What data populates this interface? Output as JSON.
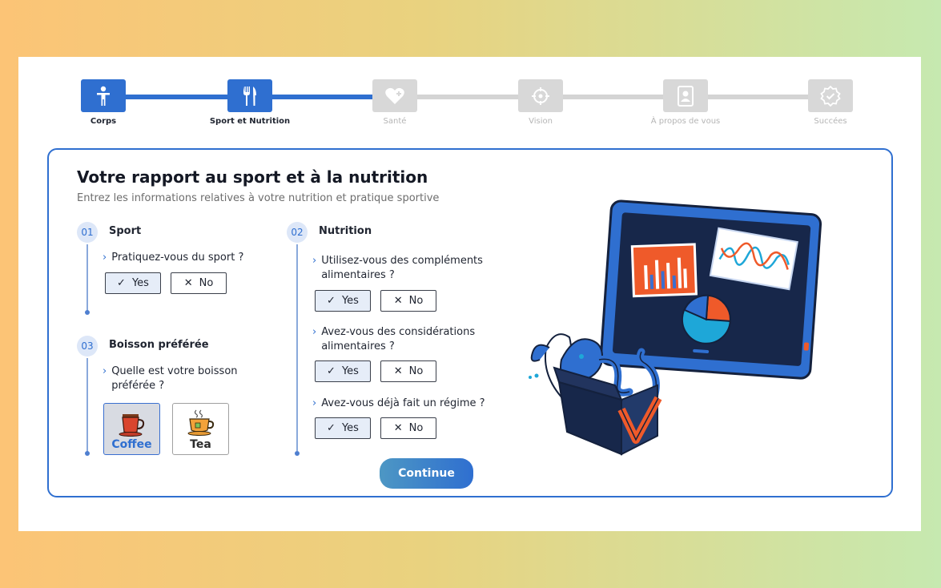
{
  "stepper": {
    "steps": [
      {
        "label": "Corps",
        "icon": "person-icon",
        "state": "done"
      },
      {
        "label": "Sport et Nutrition",
        "icon": "fork-knife-icon",
        "state": "current"
      },
      {
        "label": "Santé",
        "icon": "heart-plus-icon",
        "state": "todo"
      },
      {
        "label": "Vision",
        "icon": "target-icon",
        "state": "todo"
      },
      {
        "label": "À propos de vous",
        "icon": "profile-document-icon",
        "state": "todo"
      },
      {
        "label": "Succées",
        "icon": "check-badge-icon",
        "state": "todo"
      }
    ]
  },
  "form": {
    "title": "Votre rapport au sport et à la nutrition",
    "subtitle": "Entrez les informations relatives à votre nutrition et pratique sportive",
    "sections": {
      "sport": {
        "number": "01",
        "title": "Sport",
        "question": "Pratiquez-vous du sport ?",
        "yes": "Yes",
        "no": "No"
      },
      "nutrition": {
        "number": "02",
        "title": "Nutrition",
        "q1_line1": "Utilisez-vous des compléments",
        "q1_line2": "alimentaires ?",
        "q2_line1": "Avez-vous des considérations",
        "q2_line2": "alimentaires ?",
        "q3": "Avez-vous déjà fait un régime ?",
        "yes": "Yes",
        "no": "No"
      },
      "drink": {
        "number": "03",
        "title": "Boisson préférée",
        "q_line1": "Quelle est votre boisson",
        "q_line2": "préférée ?",
        "options": [
          "Coffee",
          "Tea"
        ],
        "selected": "Coffee"
      }
    },
    "continue_label": "Continue"
  },
  "colors": {
    "accent": "#2f6fd0",
    "inactive": "#d8d8d8",
    "illustration_orange": "#ef5a2a",
    "illustration_navy": "#1b2a4a",
    "illustration_cyan": "#1ea7d8"
  }
}
